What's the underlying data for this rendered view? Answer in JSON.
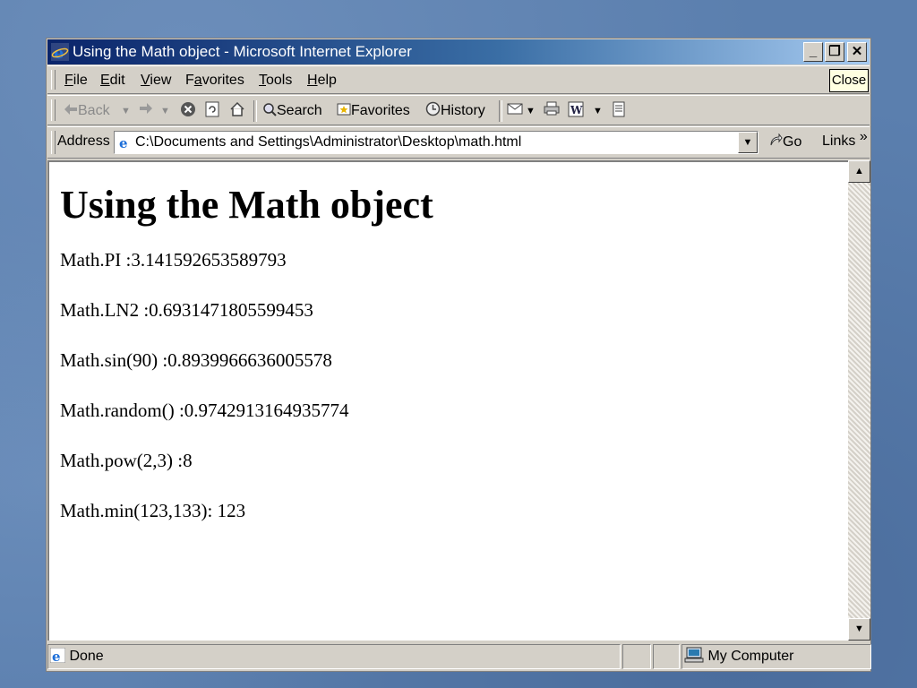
{
  "window": {
    "title": "Using the Math object - Microsoft Internet Explorer",
    "controls": {
      "minimize": "_",
      "restore": "❐",
      "close": "✕"
    }
  },
  "menubar": {
    "items": [
      {
        "label": "File",
        "accel": "F",
        "rest": "ile"
      },
      {
        "label": "Edit",
        "accel": "E",
        "rest": "dit"
      },
      {
        "label": "View",
        "accel": "V",
        "rest": "iew"
      },
      {
        "label": "Favorites",
        "accel": "a",
        "pre": "F",
        "rest": "vorites"
      },
      {
        "label": "Tools",
        "accel": "T",
        "rest": "ools"
      },
      {
        "label": "Help",
        "accel": "H",
        "rest": "elp"
      }
    ],
    "tooltip": "Close"
  },
  "toolbar": {
    "back": "Back",
    "search": "Search",
    "favorites": "Favorites",
    "history": "History"
  },
  "address": {
    "label": "Address",
    "accel": "d",
    "value": "C:\\Documents and Settings\\Administrator\\Desktop\\math.html",
    "go": "Go",
    "links": "Links",
    "links_chevron": "»"
  },
  "page": {
    "heading": "Using the Math object",
    "lines": [
      "Math.PI :3.141592653589793",
      "Math.LN2 :0.6931471805599453",
      "Math.sin(90) :0.8939966636005578",
      "Math.random() :0.9742913164935774",
      "Math.pow(2,3) :8",
      "Math.min(123,133): 123"
    ]
  },
  "status": {
    "text": "Done",
    "zone": "My Computer"
  },
  "colors": {
    "title_gradient_start": "#0a246a",
    "title_gradient_end": "#a6caf0",
    "chrome": "#d4d0c8",
    "desktop": "#5b7fae"
  }
}
